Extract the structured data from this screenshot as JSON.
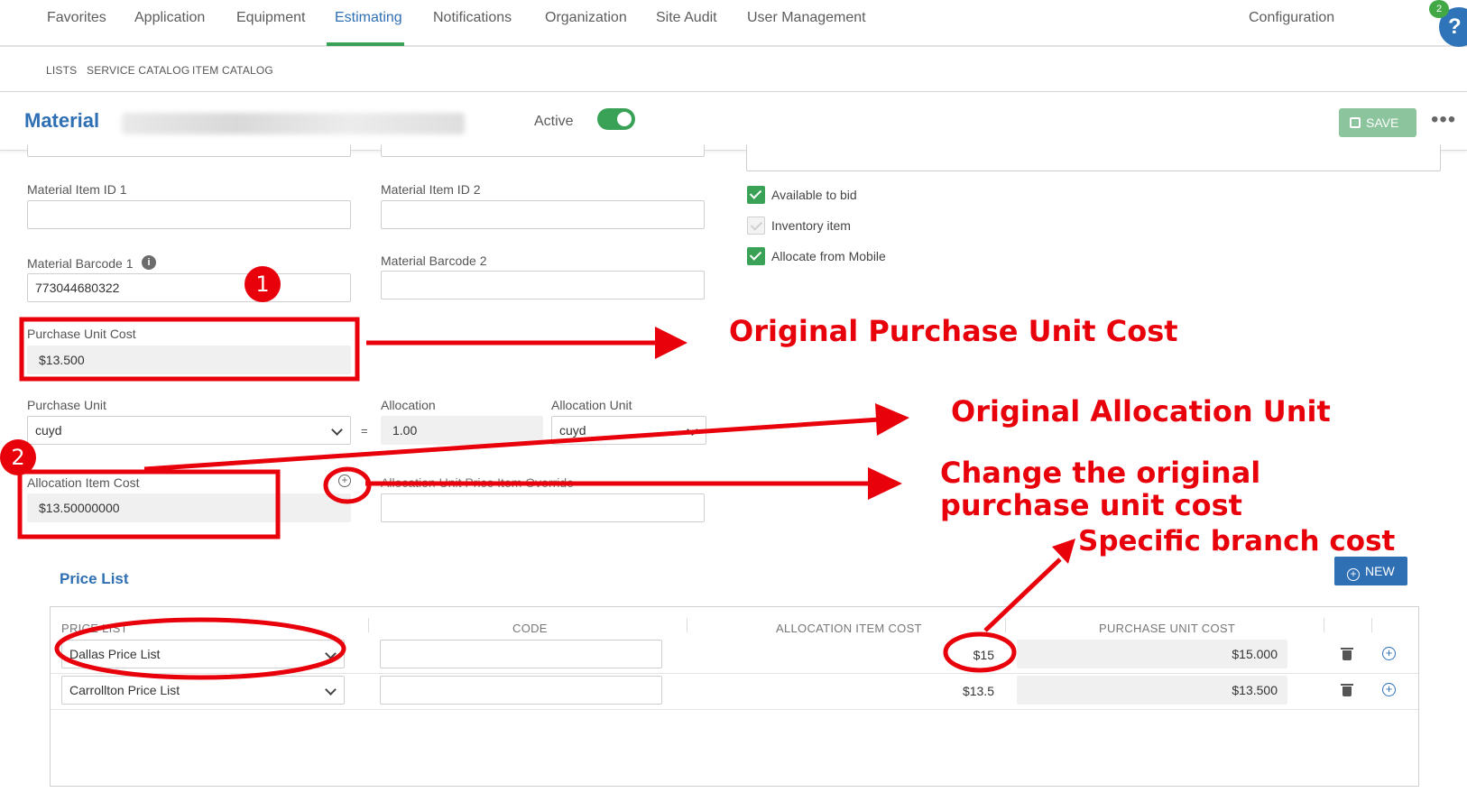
{
  "topnav": {
    "items": [
      "Favorites",
      "Application",
      "Equipment",
      "Estimating",
      "Notifications",
      "Organization",
      "Site Audit",
      "User Management"
    ],
    "config": "Configuration",
    "help_count": "2",
    "help_glyph": "?"
  },
  "subnav": {
    "items": [
      "LISTS",
      "SERVICE CATALOG",
      "ITEM CATALOG"
    ]
  },
  "header": {
    "title": "Material",
    "active_label": "Active",
    "save_label": "SAVE",
    "more_glyph": "•••"
  },
  "form": {
    "item_id_1_label": "Material Item ID 1",
    "item_id_2_label": "Material Item ID 2",
    "barcode_1_label": "Material Barcode 1",
    "barcode_1_value": "773044680322",
    "barcode_2_label": "Material Barcode 2",
    "purchase_unit_cost_label": "Purchase Unit Cost",
    "purchase_unit_cost_value": "$13.500",
    "purchase_unit_label": "Purchase Unit",
    "purchase_unit_value": "cuyd",
    "equals": "=",
    "allocation_label": "Allocation",
    "allocation_value": "1.00",
    "allocation_unit_label": "Allocation Unit",
    "allocation_unit_value": "cuyd",
    "allocation_item_cost_label": "Allocation Item Cost",
    "allocation_item_cost_value": "$13.50000000",
    "override_label": "Allocation Unit Price Item Override",
    "info_glyph": "i",
    "checkboxes": [
      {
        "label": "Available to bid",
        "checked": true
      },
      {
        "label": "Inventory item",
        "checked": false
      },
      {
        "label": "Allocate from Mobile",
        "checked": true
      }
    ]
  },
  "price_list": {
    "title": "Price List",
    "new_label": "NEW",
    "headers": [
      "PRICE LIST",
      "CODE",
      "ALLOCATION ITEM COST",
      "PURCHASE UNIT COST"
    ],
    "rows": [
      {
        "price_list": "Dallas Price List",
        "code": "",
        "allocation_cost": "$15",
        "purchase_cost": "$15.000"
      },
      {
        "price_list": "Carrollton Price List",
        "code": "",
        "allocation_cost": "$13.5",
        "purchase_cost": "$13.500"
      }
    ]
  },
  "annotations": {
    "badge_1": "1",
    "badge_2": "2",
    "original_purchase_unit_cost": "Original Purchase Unit Cost",
    "original_allocation_unit": "Original Allocation Unit",
    "change_line_1": "Change the original",
    "change_line_2": "purchase unit cost",
    "specific_branch_cost": "Specific branch cost"
  },
  "colors": {
    "brand_blue": "#2f6fb3",
    "active_green": "#3aa257",
    "annotation_red": "#e8000b"
  }
}
